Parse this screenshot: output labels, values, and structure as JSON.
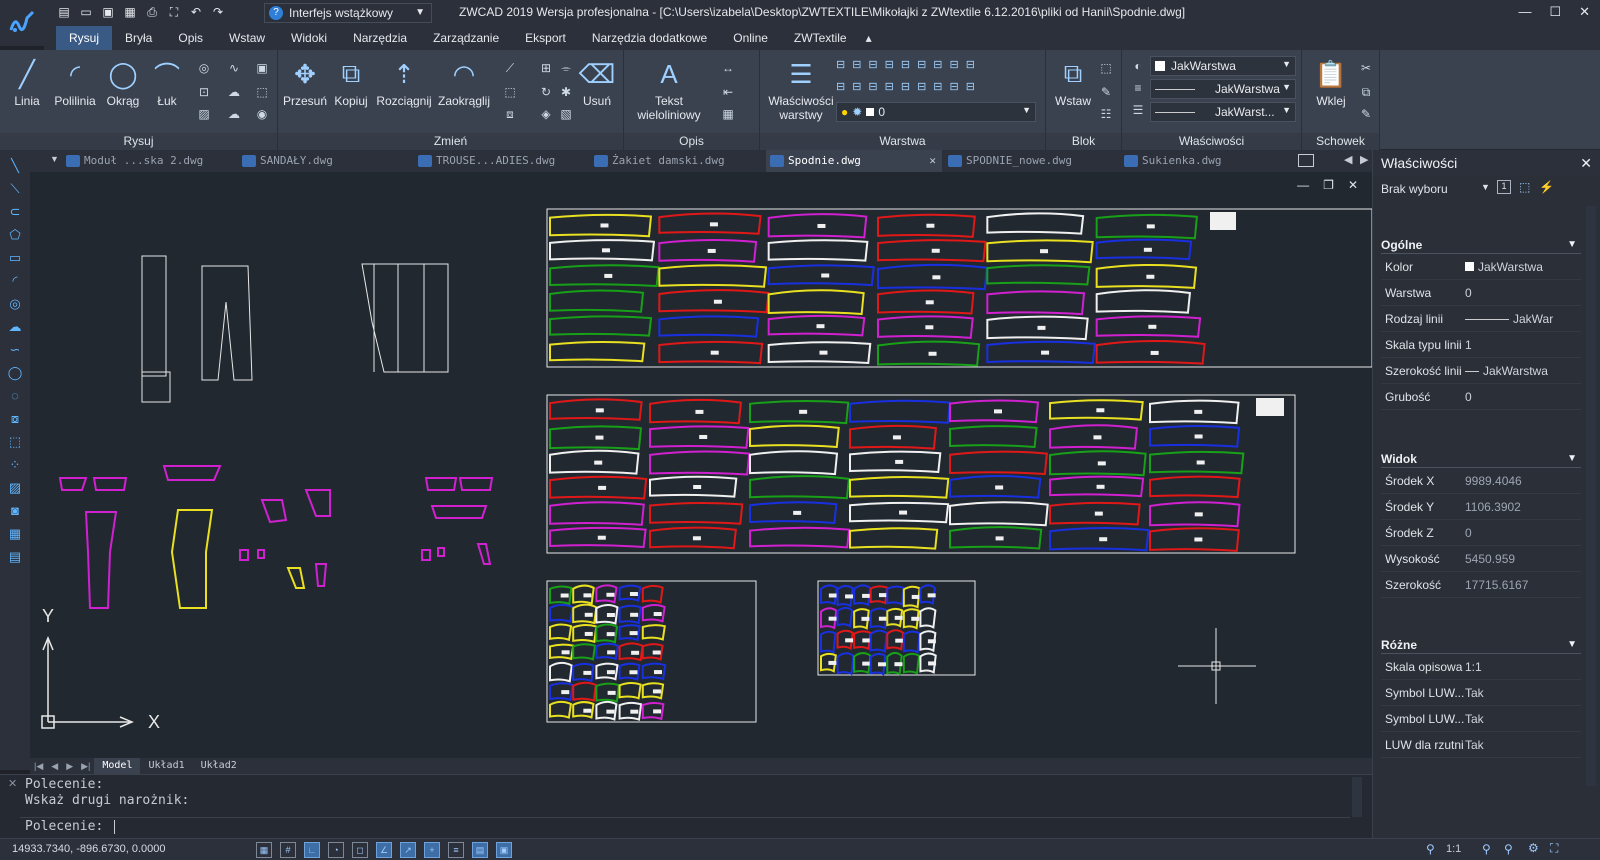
{
  "app": {
    "title": "ZWCAD 2019 Wersja profesjonalna - [C:\\Users\\izabela\\Desktop\\ZWTEXTILE\\Mikołajki z ZWtextile 6.12.2016\\pliki od Hanii\\Spodnie.dwg]",
    "workspace": "Interfejs wstążkowy"
  },
  "menu": [
    "Rysuj",
    "Bryła",
    "Opis",
    "Wstaw",
    "Widoki",
    "Narzędzia",
    "Zarządzanie",
    "Eksport",
    "Narzędzia dodatkowe",
    "Online",
    "ZWTextile"
  ],
  "ribbon": {
    "draw": {
      "title": "Rysuj",
      "line": "Linia",
      "polyline": "Polilinia",
      "circle": "Okrąg",
      "arc": "Łuk"
    },
    "modify": {
      "title": "Zmień",
      "move": "Przesuń",
      "copy": "Kopiuj",
      "stretch": "Rozciągnij",
      "fillet": "Zaokrąglij",
      "erase": "Usuń"
    },
    "annotation": {
      "title": "Opis",
      "mtext": "Tekst wieloliniowy"
    },
    "layer": {
      "title": "Warstwa",
      "props": "Właściwości warstwy",
      "current": "0"
    },
    "block": {
      "title": "Blok",
      "insert": "Wstaw"
    },
    "properties": {
      "title": "Właściwości",
      "color": "JakWarstwa",
      "linetype": "JakWarstwa",
      "lineweight": "JakWarst..."
    },
    "clipboard": {
      "title": "Schowek",
      "paste": "Wklej"
    }
  },
  "doc_tabs": [
    "Moduł ...ska 2.dwg",
    "SANDAŁY.dwg",
    "TROUSE...ADIES.dwg",
    "Żakiet damski.dwg",
    "Spodnie.dwg",
    "SPODNIE_nowe.dwg",
    "Sukienka.dwg"
  ],
  "active_tab": "Spodnie.dwg",
  "layout_tabs": [
    "Model",
    "Układ1",
    "Układ2"
  ],
  "command": {
    "line1": "Polecenie:",
    "line2": "Wskaż drugi narożnik:",
    "prompt": "Polecenie:"
  },
  "status": {
    "coords": "14933.7340, -896.6730, 0.0000",
    "scale": "1:1"
  },
  "properties": {
    "title": "Właściwości",
    "selection": "Brak wyboru",
    "general": {
      "title": "Ogólne",
      "rows": [
        {
          "k": "Kolor",
          "v": "JakWarstwa"
        },
        {
          "k": "Warstwa",
          "v": "0"
        },
        {
          "k": "Rodzaj linii",
          "v": "JakWar"
        },
        {
          "k": "Skala typu linii",
          "v": "1"
        },
        {
          "k": "Szerokość linii",
          "v": "JakWarstwa"
        },
        {
          "k": "Grubość",
          "v": "0"
        }
      ]
    },
    "view": {
      "title": "Widok",
      "rows": [
        {
          "k": "Środek X",
          "v": "9989.4046"
        },
        {
          "k": "Środek Y",
          "v": "1106.3902"
        },
        {
          "k": "Środek Z",
          "v": "0"
        },
        {
          "k": "Wysokość",
          "v": "5450.959"
        },
        {
          "k": "Szerokość",
          "v": "17715.6167"
        }
      ]
    },
    "misc": {
      "title": "Różne",
      "rows": [
        {
          "k": "Skala opisowa",
          "v": "1:1"
        },
        {
          "k": "Symbol LUW...",
          "v": "Tak"
        },
        {
          "k": "Symbol LUW...",
          "v": "Tak"
        },
        {
          "k": "LUW dla rzutni",
          "v": "Tak"
        }
      ]
    }
  },
  "axis": {
    "x": "X",
    "y": "Y"
  },
  "colors": {
    "accent": "#3a5a86",
    "canvas": "#212830",
    "pieceMagenta": "#d020d0",
    "pieceYellow": "#e8e020",
    "pieceGreen": "#18a018",
    "pieceRed": "#e01818",
    "pieceBlue": "#1830e0",
    "pieceWhite": "#f0f0f0"
  }
}
